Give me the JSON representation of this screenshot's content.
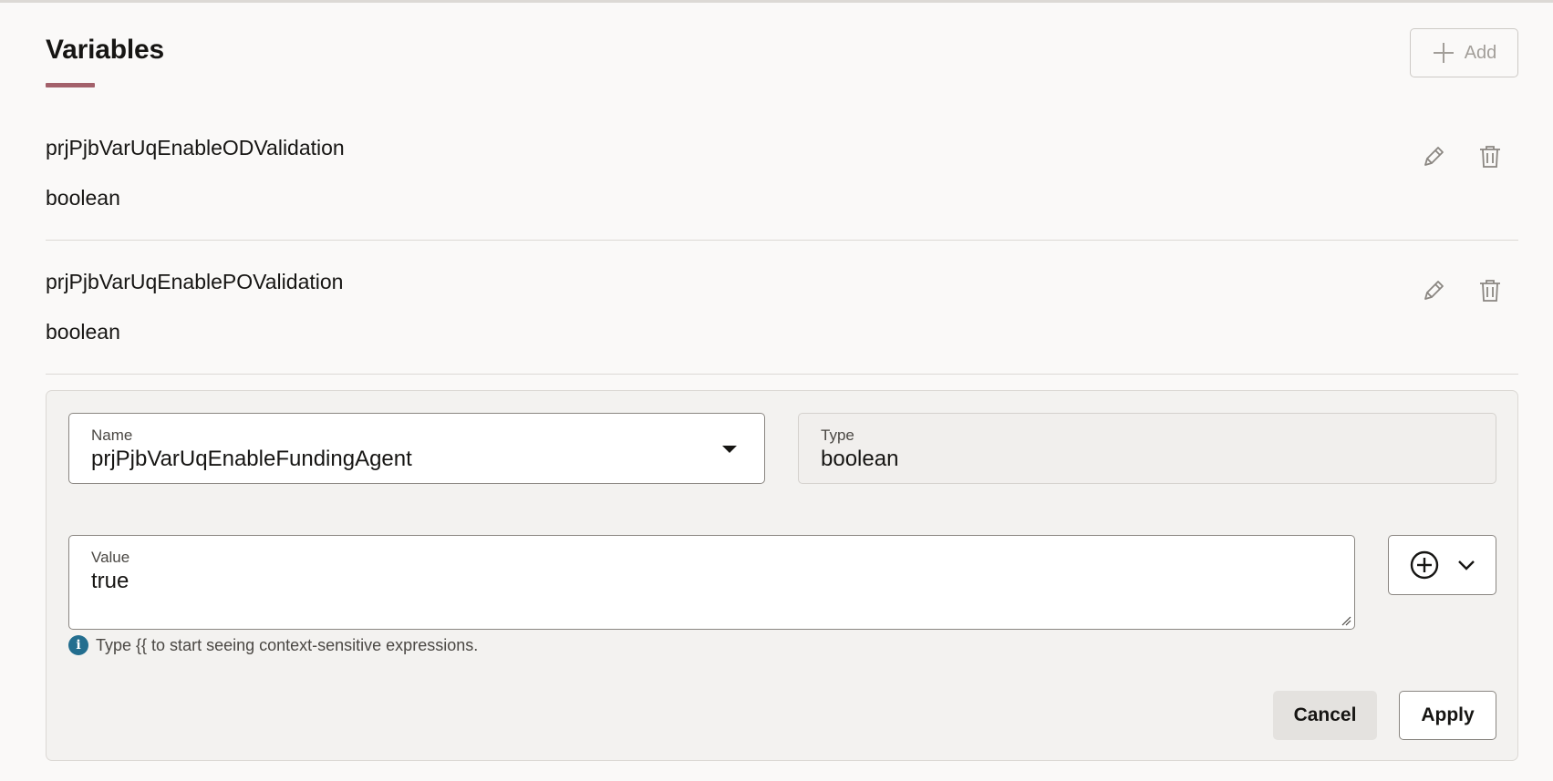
{
  "header": {
    "title": "Variables",
    "add_button": {
      "label": "Add",
      "icon": "plus-icon"
    }
  },
  "variables": [
    {
      "name": "prjPjbVarUqEnableODValidation",
      "type": "boolean"
    },
    {
      "name": "prjPjbVarUqEnablePOValidation",
      "type": "boolean"
    }
  ],
  "row_actions": {
    "edit_icon": "pencil-icon",
    "delete_icon": "trash-icon"
  },
  "editor": {
    "name_field": {
      "label": "Name",
      "value": "prjPjbVarUqEnableFundingAgent"
    },
    "type_field": {
      "label": "Type",
      "value": "boolean"
    },
    "value_field": {
      "label": "Value",
      "value": "true"
    },
    "expression_button": {
      "icon": "add-circle-icon",
      "menu_icon": "chevron-down-icon"
    },
    "hint": "Type {{ to start seeing context-sensitive expressions.",
    "cancel_label": "Cancel",
    "apply_label": "Apply"
  },
  "colors": {
    "background": "#faf9f8",
    "accent_underline": "#a3616b",
    "info_icon": "#236e8f",
    "panel_background": "#f3f2f0"
  }
}
